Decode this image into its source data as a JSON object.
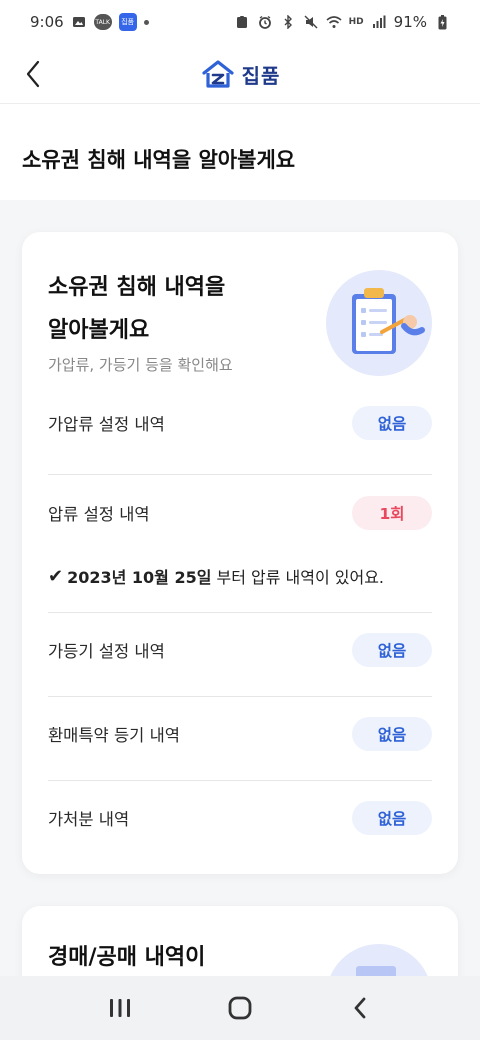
{
  "status_bar": {
    "time": "9:06",
    "talk_badge": "TALK",
    "app_badge": "집품",
    "battery_percent": "91%",
    "hd_label": "HD"
  },
  "header": {
    "brand_name": "집품"
  },
  "page": {
    "title": "소유권 침해 내역을 알아볼게요"
  },
  "card1": {
    "heading_line1": "소유권 침해 내역을",
    "heading_line2": "알아볼게요",
    "subtitle": "가압류, 가등기 등을 확인해요",
    "rows": [
      {
        "label": "가압류 설정 내역",
        "value": "없음",
        "status": "none"
      },
      {
        "label": "압류 설정 내역",
        "value": "1회",
        "status": "warn"
      },
      {
        "label": "가등기 설정 내역",
        "value": "없음",
        "status": "none"
      },
      {
        "label": "환매특약 등기 내역",
        "value": "없음",
        "status": "none"
      },
      {
        "label": "가처분 내역",
        "value": "없음",
        "status": "none"
      }
    ],
    "note": {
      "check": "✔",
      "date": "2023년 10월 25일",
      "text": "부터 압류 내역이 있어요."
    }
  },
  "card2": {
    "heading": "경매/공매 내역이"
  },
  "colors": {
    "accent": "#2e62d6",
    "warn": "#e8495f",
    "brand": "#1f3a8a"
  }
}
